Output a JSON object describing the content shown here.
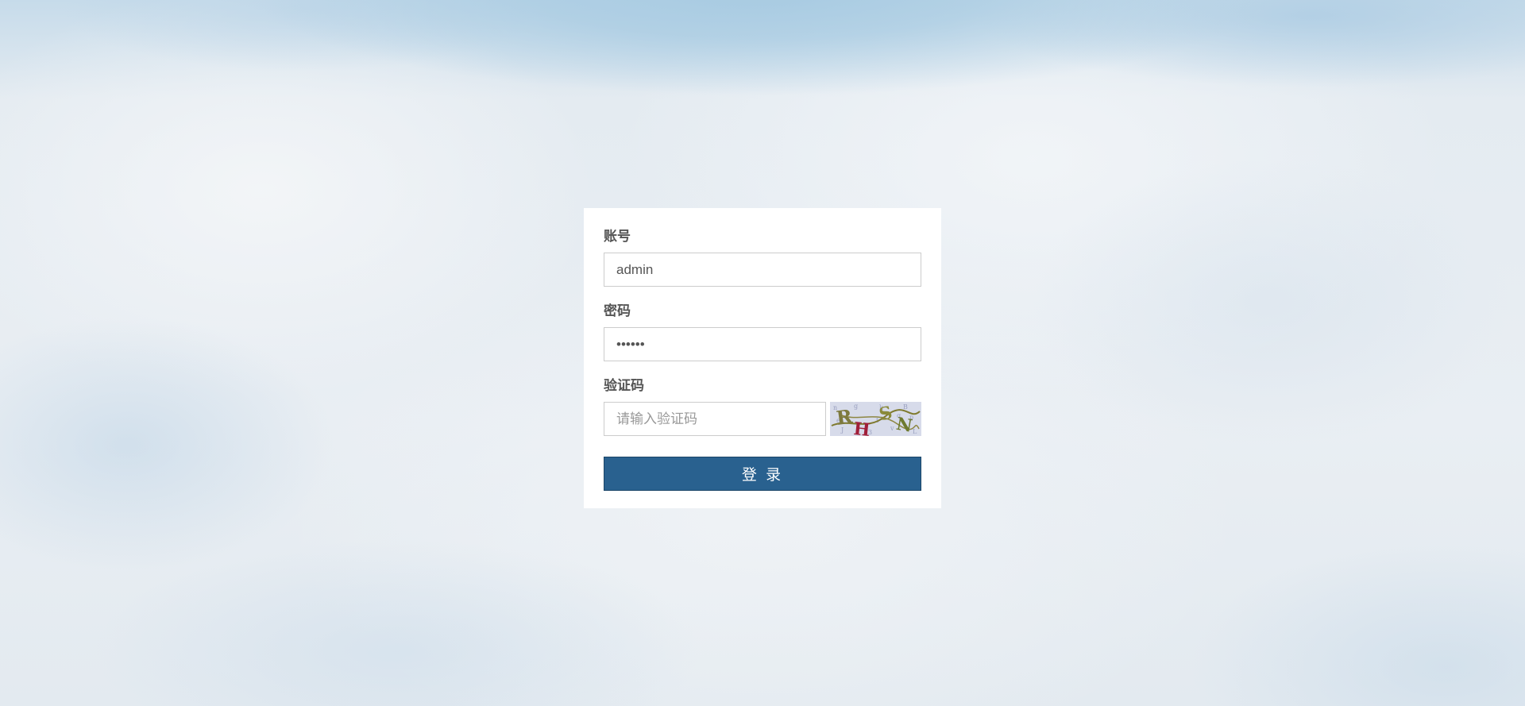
{
  "login_form": {
    "account": {
      "label": "账号",
      "value": "admin"
    },
    "password": {
      "label": "密码",
      "value": "••••••"
    },
    "captcha": {
      "label": "验证码",
      "placeholder": "请输入验证码",
      "value": "",
      "image_text": "RHSN"
    },
    "submit_label": "登 录"
  },
  "colors": {
    "button": "#29618f",
    "card": "#ffffff",
    "label": "#555555"
  }
}
